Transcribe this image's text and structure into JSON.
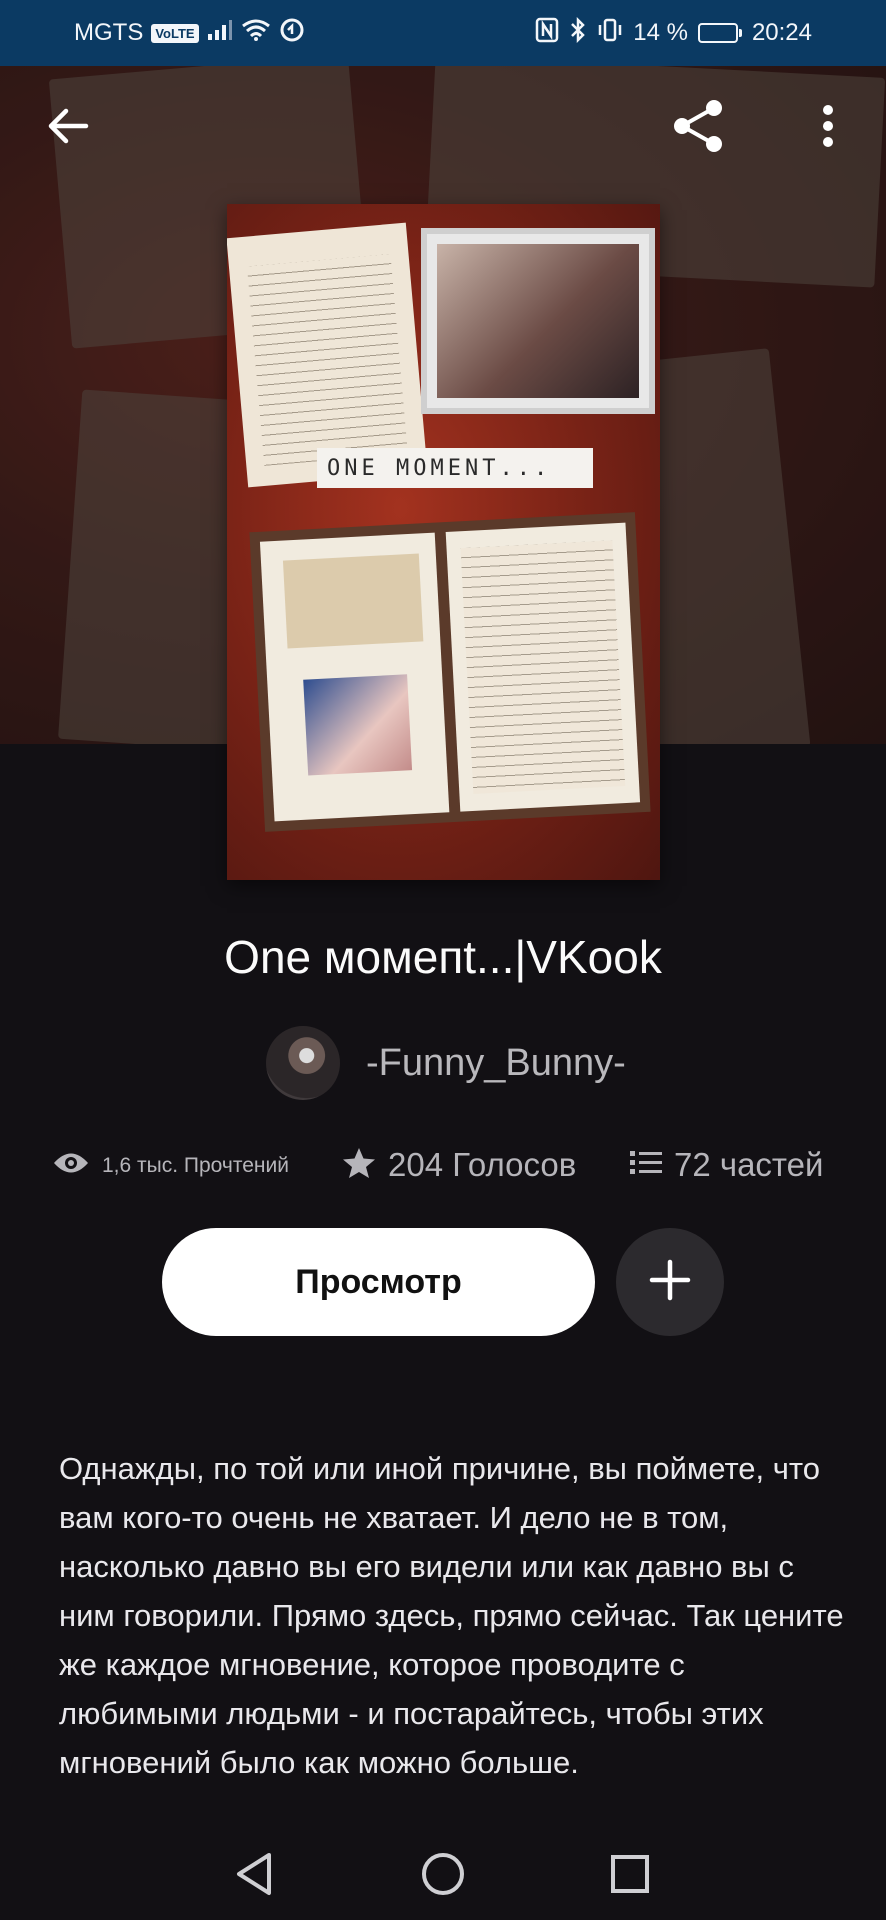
{
  "status_bar": {
    "carrier": "MGTS",
    "volte_label": "VoLTE",
    "battery_text": "14 %",
    "battery_level": 0.14,
    "time": "20:24",
    "icons": [
      "signal-icon",
      "wifi-icon",
      "data-saver-icon",
      "nfc-icon",
      "bluetooth-icon",
      "vibrate-icon",
      "battery-icon"
    ]
  },
  "topbar": {
    "back_icon": "arrow-left-icon",
    "share_icon": "share-icon",
    "menu_icon": "more-vertical-icon"
  },
  "cover": {
    "label_text": "ONE MOMENT..."
  },
  "story": {
    "title": "One мoмeпt...|VKook",
    "author": "-Funny_Bunny-",
    "reads_value": "1,6 тыс. Прочтений",
    "votes_value": "204 Голосов",
    "parts_value": "72 частей",
    "description": "Однажды, по той или иной причине, вы поймете, что вам кого-то очень не хватает. И дело не в том, насколько давно вы его видели или как давно вы с ним говорили. Прямо здесь, прямо сейчас. Так цените же каждое мгновение, которое проводите с любимыми людьми - и постарайтесь, чтобы этих мгновений было как можно больше."
  },
  "actions": {
    "view_label": "Просмотр",
    "add_icon": "plus-icon"
  },
  "nav": {
    "icons": [
      "nav-back-icon",
      "nav-home-icon",
      "nav-recents-icon"
    ]
  },
  "colors": {
    "status_bar_bg": "#0b3a63",
    "page_bg": "#121014",
    "primary_button_bg": "#ffffff",
    "secondary_button_bg": "#2c2a2e",
    "muted_text": "#b6b5ba"
  }
}
